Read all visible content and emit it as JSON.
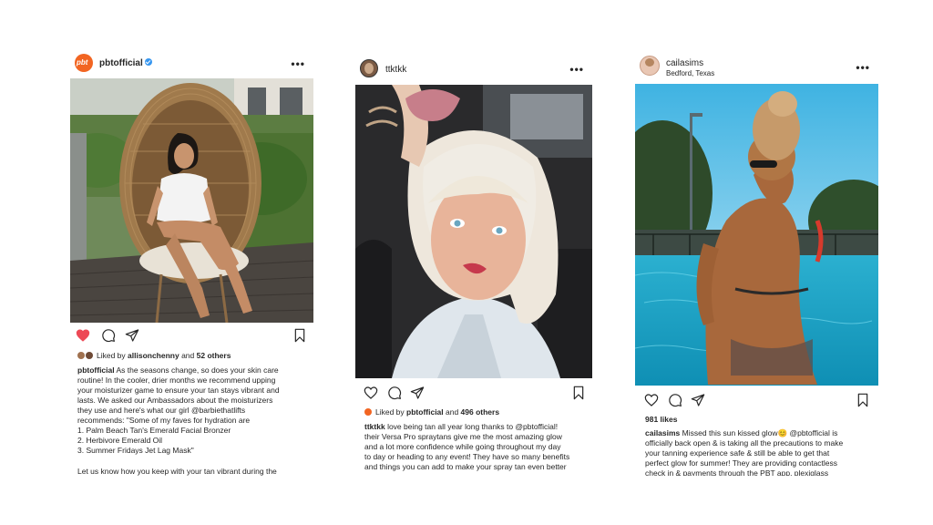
{
  "posts": [
    {
      "username": "pbtofficial",
      "avatar_text": "pbt",
      "verified": true,
      "more": "•••",
      "liked_prefix": "Liked by ",
      "liked_user": "allisonchenny",
      "liked_mid": " and ",
      "liked_others": "52 others",
      "heart_filled": true,
      "caption_user": "pbtofficial",
      "caption_lines": [
        "As the seasons change, so does your skin care",
        "routine! In the cooler, drier months we recommend upping",
        "your moisturizer game to ensure your tan stays vibrant and",
        "lasts. We asked our Ambassadors about the moisturizers",
        "they use and here's what our girl @barbiethatlifts",
        "recommends: \"Some of my faves for hydration are",
        "1. Palm Beach Tan's Emerald Facial Bronzer",
        "2. Herbivore Emerald Oil",
        "3. Summer Fridays Jet Lag Mask\""
      ],
      "caption_tail": "Let us know how  you keep with your tan vibrant during the"
    },
    {
      "username": "ttktkk",
      "more": "•••",
      "liked_prefix": "Liked by ",
      "liked_user": "pbtofficial",
      "liked_mid": " and ",
      "liked_others": "496 others",
      "heart_filled": false,
      "caption_user": "ttktkk",
      "caption_lines": [
        "love being tan all year long thanks to @pbtofficial!",
        "their Versa Pro spraytans give me the most amazing glow",
        "and a lot more confidence while going throughout my day",
        "to day or heading to any event! They have so many benefits",
        "and things you can add to make your spray tan even better"
      ]
    },
    {
      "username": "cailasims",
      "location": "Bedford, Texas",
      "more": "•••",
      "likes": "981 likes",
      "heart_filled": false,
      "caption_user": "cailasims",
      "caption_lines": [
        "Missed this sun kissed glow😊 @pbtofficial is",
        "officially back open & is taking all the precautions to make",
        "your tanning experience safe & still be able to get that",
        "perfect glow for summer! They are providing contactless",
        "check in & payments through the PBT app, plexiglass"
      ]
    }
  ],
  "colors": {
    "heart_red": "#ed4956",
    "avatar_orange": "#f26522",
    "verified_blue": "#3897f0"
  },
  "icons": [
    "heart-icon",
    "comment-icon",
    "share-icon",
    "bookmark-icon",
    "more-icon"
  ]
}
